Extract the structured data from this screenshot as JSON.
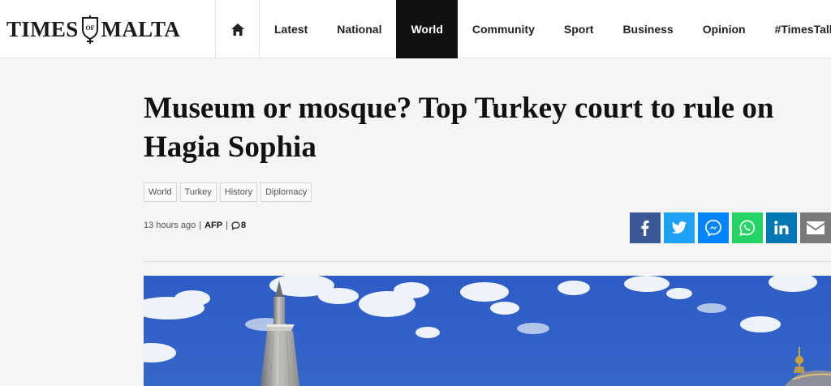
{
  "brand": {
    "word_left": "TIMES",
    "crest_text": "OF",
    "word_right": "MALTA"
  },
  "nav": {
    "items": [
      {
        "label": "Latest"
      },
      {
        "label": "National"
      },
      {
        "label": "World",
        "active": true
      },
      {
        "label": "Community"
      },
      {
        "label": "Sport"
      },
      {
        "label": "Business"
      },
      {
        "label": "Opinion"
      },
      {
        "label": "#TimesTalk"
      }
    ]
  },
  "article": {
    "title": "Museum or mosque? Top Turkey court to rule on Hagia Sophia",
    "tags": [
      "World",
      "Turkey",
      "History",
      "Diplomacy"
    ],
    "time": "13 hours ago",
    "separator": "|",
    "author": "AFP",
    "comment_count": "8"
  },
  "share": [
    {
      "name": "facebook",
      "icon": "facebook-icon",
      "color": "#3b5998"
    },
    {
      "name": "twitter",
      "icon": "twitter-icon",
      "color": "#1da1f2"
    },
    {
      "name": "messenger",
      "icon": "messenger-icon",
      "color": "#0084ff"
    },
    {
      "name": "whatsapp",
      "icon": "whatsapp-icon",
      "color": "#25d366"
    },
    {
      "name": "linkedin",
      "icon": "linkedin-icon",
      "color": "#0077b5"
    },
    {
      "name": "email",
      "icon": "email-icon",
      "color": "#7a7a7a"
    }
  ],
  "colors": {
    "nav_active_bg": "#111111",
    "sky": "#2f5ec4"
  }
}
